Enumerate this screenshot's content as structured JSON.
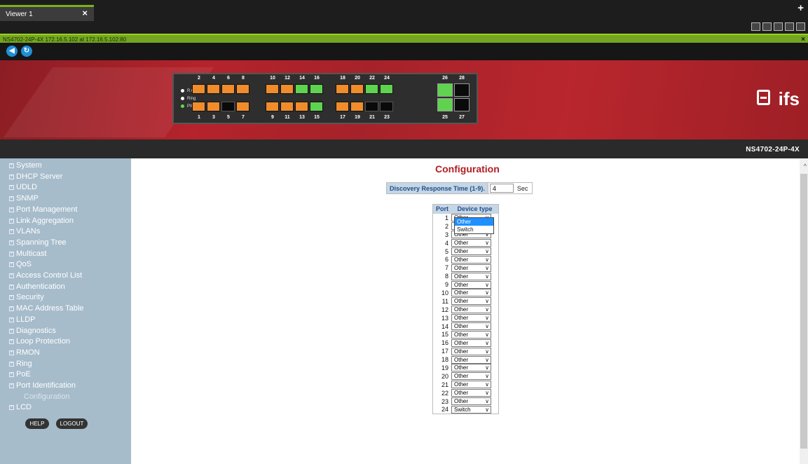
{
  "viewer": {
    "tab_label": "Viewer 1",
    "close_glyph": "×",
    "add_glyph": "+"
  },
  "url": {
    "text": "NS4702-24P-4X 172.16.5.102 at 172.16.5.102:80",
    "close_glyph": "×"
  },
  "toolbar_icons": [
    "app-icon",
    "lock-icon",
    "check-icon",
    "fullscreen-icon",
    "close-window-icon"
  ],
  "nav": {
    "back_glyph": "◀",
    "refresh_glyph": "↻"
  },
  "panel": {
    "leds": [
      {
        "label": "R.O",
        "color": "#ffffff"
      },
      {
        "label": "Ring",
        "color": "#ffffff"
      },
      {
        "label": "PWR",
        "color": "#5ce040"
      }
    ],
    "top_numbers": [
      "2",
      "4",
      "6",
      "8",
      "10",
      "12",
      "14",
      "16",
      "18",
      "20",
      "22",
      "24",
      "26",
      "28"
    ],
    "bottom_numbers": [
      "1",
      "3",
      "5",
      "7",
      "9",
      "11",
      "13",
      "15",
      "17",
      "19",
      "21",
      "23",
      "25",
      "27"
    ],
    "top_ports": [
      "orange",
      "orange",
      "orange",
      "orange",
      "orange",
      "orange",
      "green",
      "green",
      "orange",
      "orange",
      "green",
      "green"
    ],
    "bottom_ports": [
      "orange",
      "orange",
      "black",
      "orange",
      "orange",
      "orange",
      "orange",
      "green",
      "orange",
      "orange",
      "black",
      "black"
    ],
    "sfp_top": [
      "green",
      "black"
    ],
    "sfp_bottom": [
      "green",
      "black"
    ]
  },
  "brand": {
    "logo": "ifs",
    "model": "NS4702-24P-4X"
  },
  "sidebar": {
    "items": [
      "System",
      "DHCP Server",
      "UDLD",
      "SNMP",
      "Port Management",
      "Link Aggregation",
      "VLANs",
      "Spanning Tree",
      "Multicast",
      "QoS",
      "Access Control List",
      "Authentication",
      "Security",
      "MAC Address Table",
      "LLDP",
      "Diagnostics",
      "Loop Protection",
      "RMON",
      "Ring",
      "PoE",
      "Port Identification"
    ],
    "active_item": "Configuration",
    "last_item": "LCD",
    "help": "HELP",
    "logout": "LOGOUT"
  },
  "main": {
    "title": "Configuration",
    "drt_label": "Discovery Response Time (1-9).",
    "drt_value": "4",
    "drt_unit": "Sec",
    "col_port": "Port",
    "col_type": "Device type",
    "rows": [
      {
        "port": "1",
        "type": "Other"
      },
      {
        "port": "2",
        "type": "Switch"
      },
      {
        "port": "3",
        "type": "Other"
      },
      {
        "port": "4",
        "type": "Other"
      },
      {
        "port": "5",
        "type": "Other"
      },
      {
        "port": "6",
        "type": "Other"
      },
      {
        "port": "7",
        "type": "Other"
      },
      {
        "port": "8",
        "type": "Other"
      },
      {
        "port": "9",
        "type": "Other"
      },
      {
        "port": "10",
        "type": "Other"
      },
      {
        "port": "11",
        "type": "Other"
      },
      {
        "port": "12",
        "type": "Other"
      },
      {
        "port": "13",
        "type": "Other"
      },
      {
        "port": "14",
        "type": "Other"
      },
      {
        "port": "15",
        "type": "Other"
      },
      {
        "port": "16",
        "type": "Other"
      },
      {
        "port": "17",
        "type": "Other"
      },
      {
        "port": "18",
        "type": "Other"
      },
      {
        "port": "19",
        "type": "Other"
      },
      {
        "port": "20",
        "type": "Other"
      },
      {
        "port": "21",
        "type": "Other"
      },
      {
        "port": "22",
        "type": "Other"
      },
      {
        "port": "23",
        "type": "Other"
      },
      {
        "port": "24",
        "type": "Switch"
      }
    ],
    "dropdown_options": [
      "Other",
      "Switch"
    ],
    "dropdown_highlight": 0
  }
}
